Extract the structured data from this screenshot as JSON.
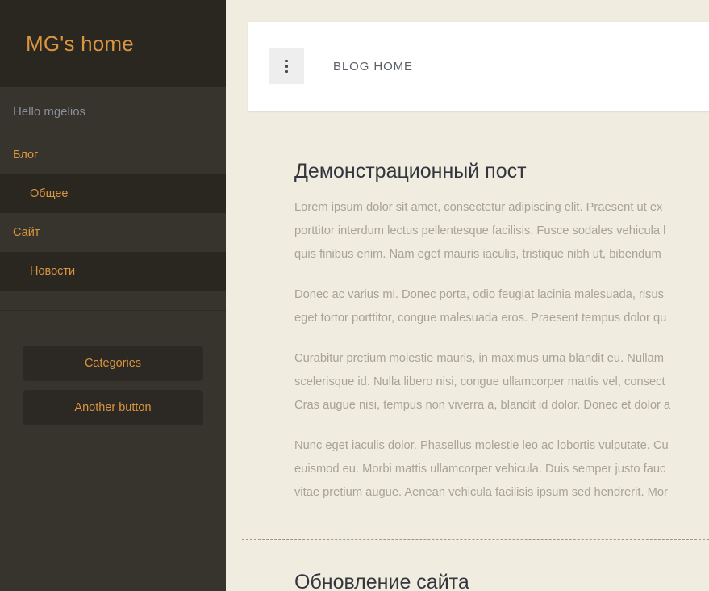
{
  "sidebar": {
    "brand": "MG's home",
    "greeting": "Hello mgelios",
    "nav": [
      {
        "type": "group",
        "label": "Блог",
        "name": "nav-group-blog"
      },
      {
        "type": "item",
        "label": "Общее",
        "name": "nav-item-obshee"
      },
      {
        "type": "group",
        "label": "Сайт",
        "name": "nav-group-site"
      },
      {
        "type": "item",
        "label": "Новости",
        "name": "nav-item-novosti"
      }
    ],
    "buttons": [
      {
        "label": "Categories",
        "name": "categories-button"
      },
      {
        "label": "Another button",
        "name": "another-button"
      }
    ]
  },
  "topbar": {
    "menu_icon": "three-dots-vertical-icon",
    "title": "BLOG HOME"
  },
  "posts": [
    {
      "title": "Демонстрационный пост",
      "paragraphs": [
        "Lorem ipsum dolor sit amet, consectetur adipiscing elit. Praesent ut ex\nporttitor interdum lectus pellentesque facilisis. Fusce sodales vehicula l\nquis finibus enim. Nam eget mauris iaculis, tristique nibh ut, bibendum",
        "Donec ac varius mi. Donec porta, odio feugiat lacinia malesuada, risus\neget tortor porttitor, congue malesuada eros. Praesent tempus dolor qu",
        "Curabitur pretium molestie mauris, in maximus urna blandit eu. Nullam\nscelerisque id. Nulla libero nisi, congue ullamcorper mattis vel, consect\nCras augue nisi, tempus non viverra a, blandit id dolor. Donec et dolor a",
        "Nunc eget iaculis dolor. Phasellus molestie leo ac lobortis vulputate. Cu\neuismod eu. Morbi mattis ullamcorper vehicula. Duis semper justo fauc\nvitae pretium augue. Aenean vehicula facilisis ipsum sed hendrerit. Mor"
      ]
    },
    {
      "title": "Обновление сайта",
      "paragraphs": []
    }
  ],
  "colors": {
    "sidebar_bg": "#37332d",
    "sidebar_dark": "#2a2620",
    "accent": "#d9953f",
    "page_bg": "#f0ece0",
    "body_text": "#a8a396",
    "heading_text": "#33363d",
    "topbar_title": "#5b6168",
    "card_bg": "#ffffff"
  }
}
